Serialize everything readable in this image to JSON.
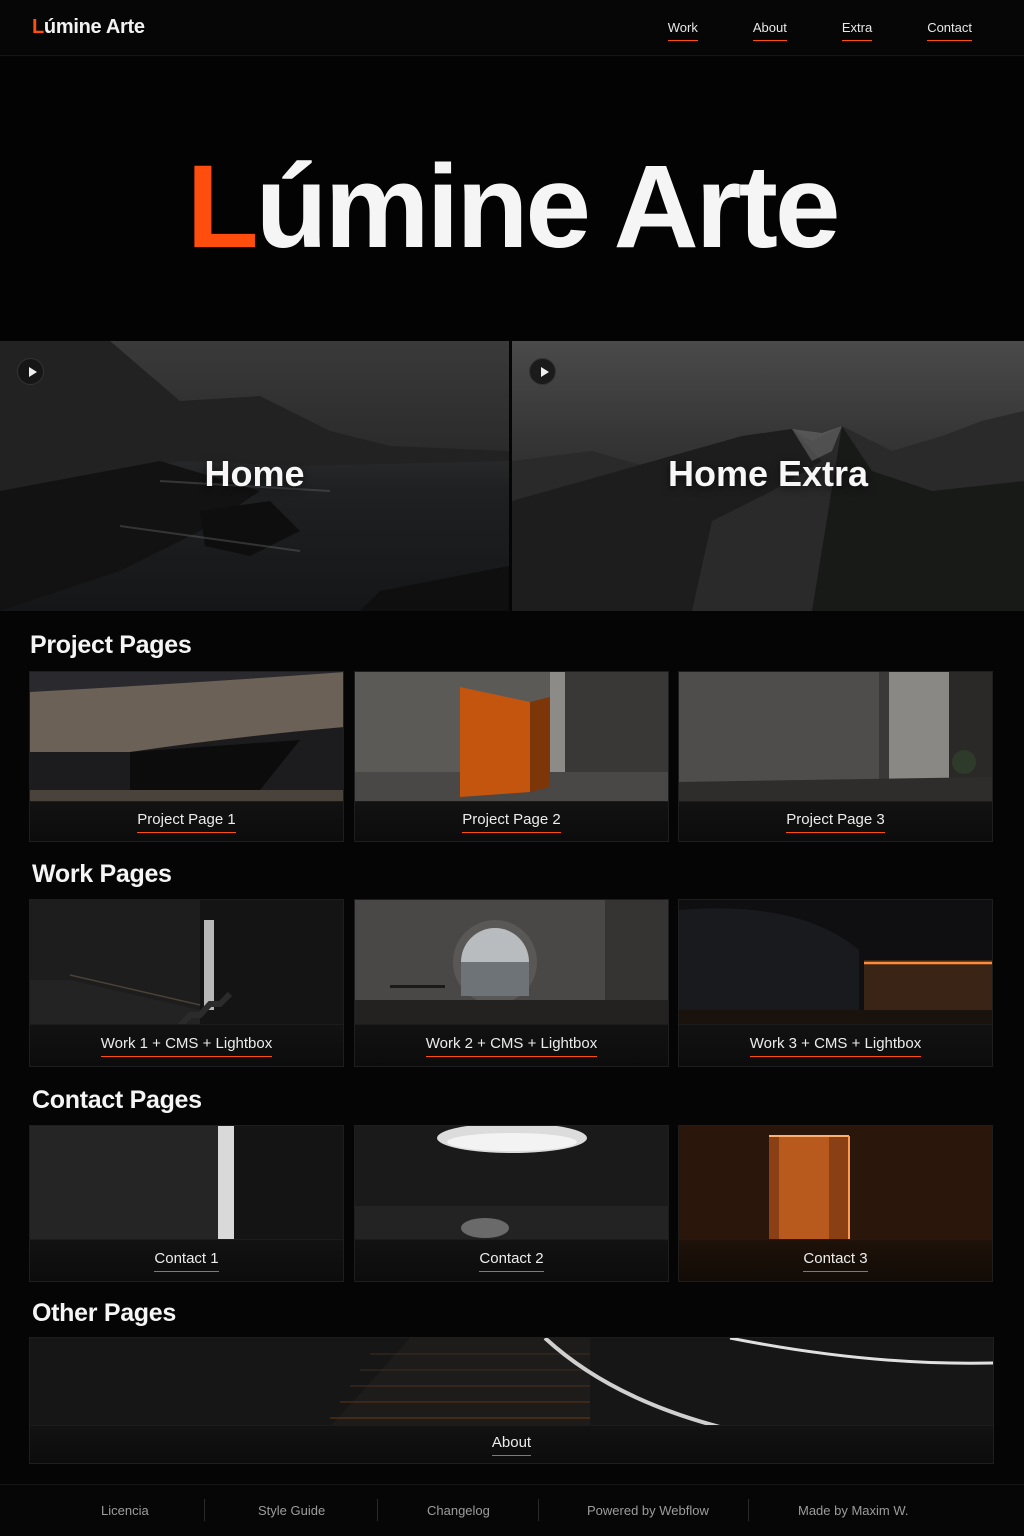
{
  "brand": {
    "initial": "L",
    "rest": "úmine Arte"
  },
  "nav": {
    "links": [
      "Work",
      "About",
      "Extra",
      "Contact"
    ]
  },
  "hero": {
    "initial": "L",
    "rest": "úmine Arte"
  },
  "tiles": [
    {
      "label": "Home"
    },
    {
      "label": "Home Extra"
    }
  ],
  "sections": {
    "project": {
      "title": "Project Pages",
      "cards": [
        "Project Page 1",
        "Project Page 2",
        "Project Page 3"
      ]
    },
    "work": {
      "title": "Work Pages",
      "cards": [
        "Work 1 + CMS + Lightbox",
        "Work 2 + CMS + Lightbox",
        "Work 3 + CMS + Lightbox"
      ]
    },
    "contact": {
      "title": "Contact Pages",
      "cards": [
        "Contact 1",
        "Contact 2",
        "Contact 3"
      ]
    },
    "other": {
      "title": "Other Pages",
      "cards": [
        "About"
      ]
    }
  },
  "footer": {
    "items": [
      "Licencia",
      "Style Guide",
      "Changelog",
      "Powered by Webflow",
      "Made by Maxim W."
    ]
  },
  "colors": {
    "accent": "#ff4d0d",
    "background": "#050505"
  }
}
